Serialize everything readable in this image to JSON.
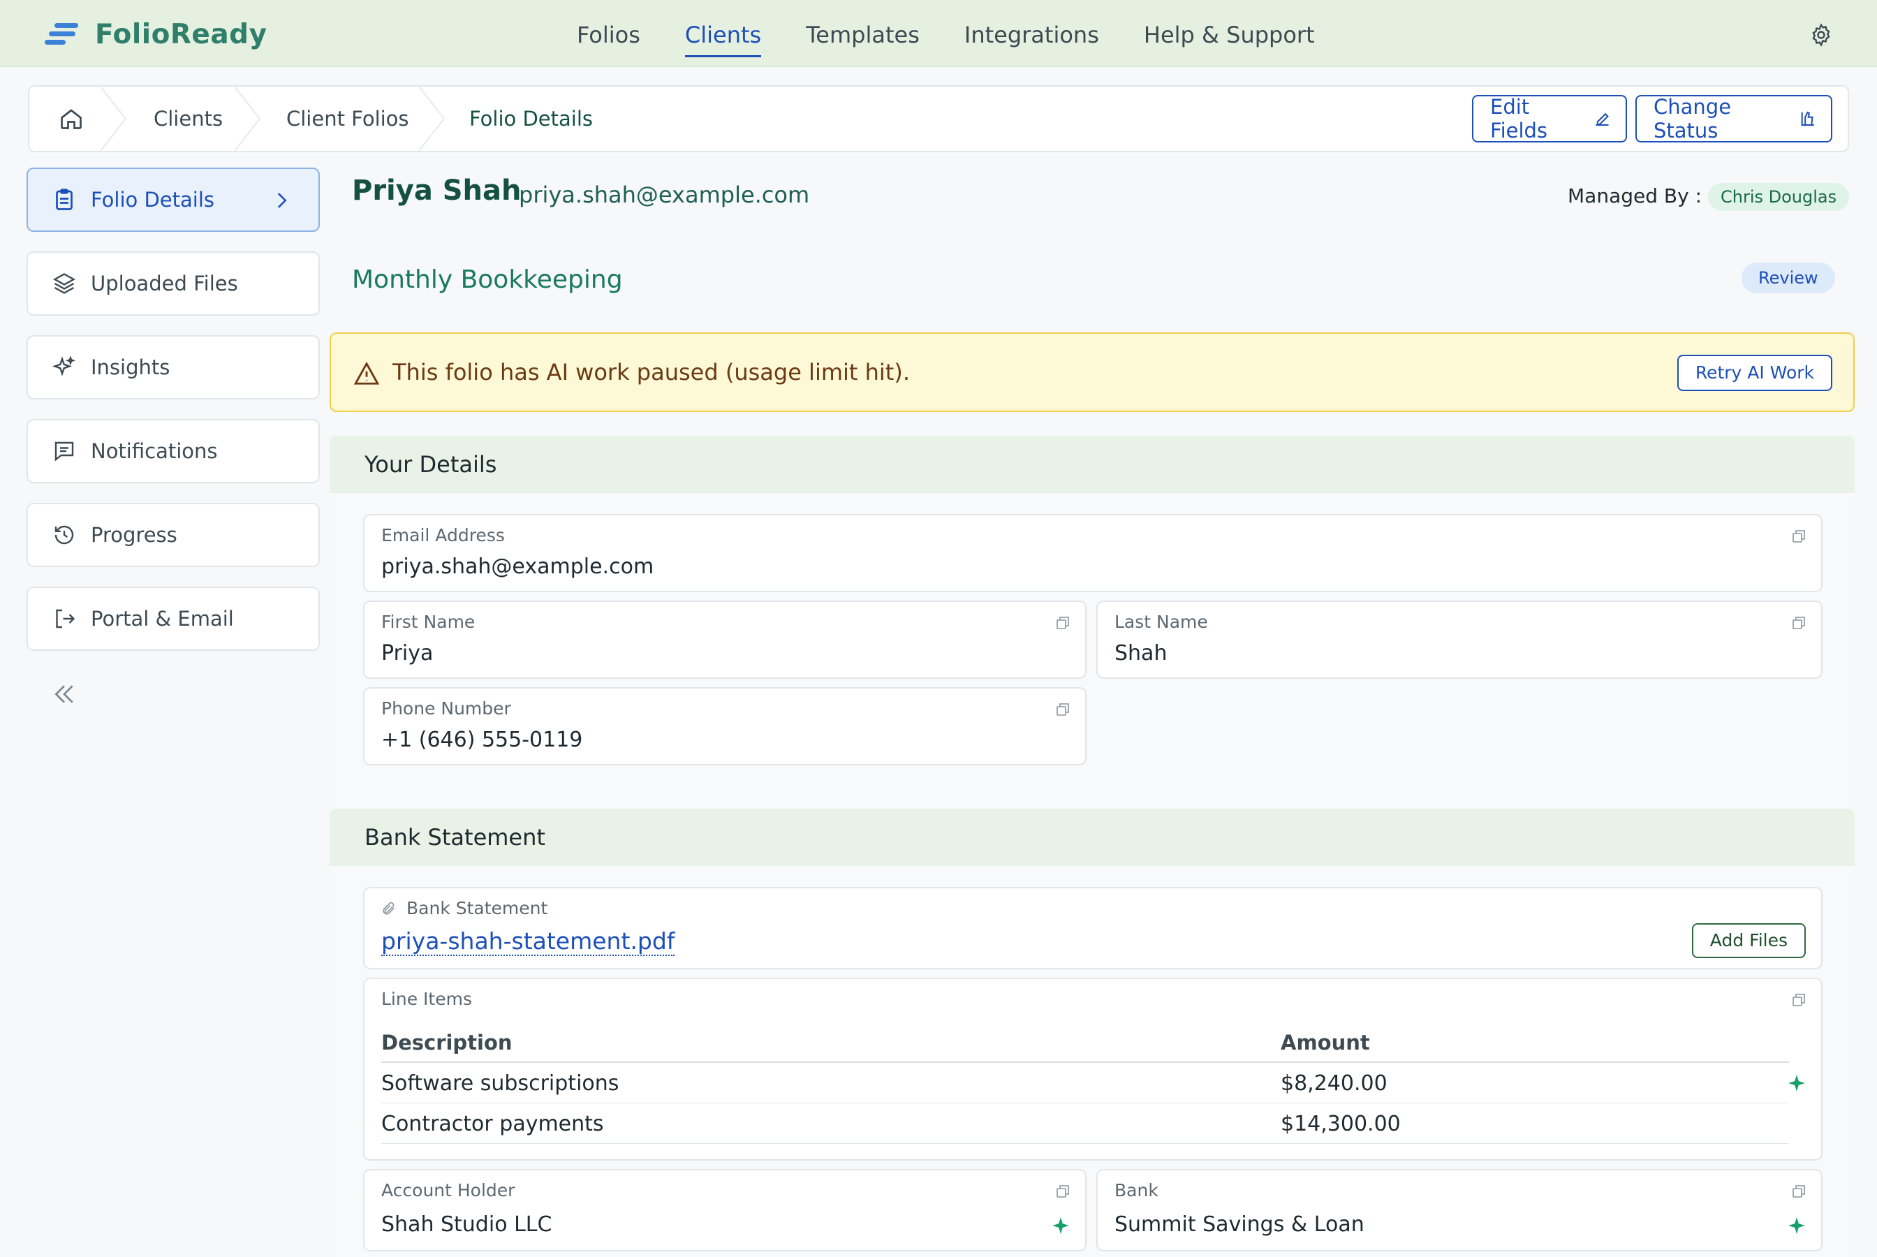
{
  "app": {
    "name": "FolioReady"
  },
  "nav": {
    "items": [
      {
        "label": "Folios",
        "active": false
      },
      {
        "label": "Clients",
        "active": true
      },
      {
        "label": "Templates",
        "active": false
      },
      {
        "label": "Integrations",
        "active": false
      },
      {
        "label": "Help & Support",
        "active": false
      }
    ]
  },
  "breadcrumb": {
    "home": "home-icon",
    "items": [
      "Clients",
      "Client Folios",
      "Folio Details"
    ]
  },
  "actions": {
    "edit_fields": "Edit Fields",
    "change_status": "Change Status"
  },
  "sidebar": {
    "items": [
      {
        "label": "Folio Details",
        "icon": "clipboard-icon",
        "active": true
      },
      {
        "label": "Uploaded Files",
        "icon": "layers-icon",
        "active": false
      },
      {
        "label": "Insights",
        "icon": "sparkles-icon",
        "active": false
      },
      {
        "label": "Notifications",
        "icon": "message-icon",
        "active": false
      },
      {
        "label": "Progress",
        "icon": "history-icon",
        "active": false
      },
      {
        "label": "Portal & Email",
        "icon": "logout-icon",
        "active": false
      }
    ]
  },
  "client": {
    "name": "Priya Shah",
    "email": "priya.shah@example.com",
    "managed_by_label": "Managed By :",
    "managed_by": "Chris Douglas"
  },
  "folio": {
    "title": "Monthly Bookkeeping",
    "status": "Review"
  },
  "alert": {
    "text": "This folio has AI work paused (usage limit hit).",
    "action": "Retry AI Work"
  },
  "your_details": {
    "title": "Your Details",
    "email": {
      "label": "Email Address",
      "value": "priya.shah@example.com"
    },
    "first_name": {
      "label": "First Name",
      "value": "Priya"
    },
    "last_name": {
      "label": "Last Name",
      "value": "Shah"
    },
    "phone": {
      "label": "Phone Number",
      "value": "+1 (646) 555-0119"
    }
  },
  "bank_statement": {
    "title": "Bank Statement",
    "file_label": "Bank Statement",
    "file_name": "priya-shah-statement.pdf",
    "add_files": "Add Files",
    "line_items": {
      "label": "Line Items",
      "columns": [
        "Description",
        "Amount"
      ],
      "rows": [
        {
          "description": "Software subscriptions",
          "amount": "$8,240.00"
        },
        {
          "description": "Contractor payments",
          "amount": "$14,300.00"
        }
      ]
    },
    "account_holder": {
      "label": "Account Holder",
      "value": "Shah Studio LLC"
    },
    "bank": {
      "label": "Bank",
      "value": "Summit Savings & Loan"
    }
  },
  "colors": {
    "accent": "#1d4fb8",
    "brand": "#2f7f6a",
    "ai_spark": "#16a06a"
  }
}
